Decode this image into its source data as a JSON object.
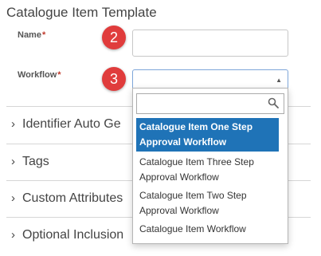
{
  "form": {
    "title": "Catalogue Item Template",
    "name_label": "Name",
    "workflow_label": "Workflow",
    "required_marker": "*",
    "name_value": "",
    "workflow_value": ""
  },
  "badges": {
    "name_step": "2",
    "workflow_step": "3"
  },
  "sections": [
    {
      "title": "Identifier Auto Ge",
      "icon": "chevron-right-icon"
    },
    {
      "title": "Tags",
      "icon": "chevron-right-icon"
    },
    {
      "title": "Custom Attributes",
      "icon": "chevron-right-icon"
    },
    {
      "title": "Optional Inclusion",
      "icon": "chevron-right-icon"
    }
  ],
  "dropdown": {
    "search_value": "",
    "options": [
      {
        "label": "Catalogue Item One Step Approval Workflow",
        "selected": true
      },
      {
        "label": "Catalogue Item Three Step Approval Workflow",
        "selected": false
      },
      {
        "label": "Catalogue Item Two Step Approval Workflow",
        "selected": false
      },
      {
        "label": "Catalogue Item Workflow",
        "selected": false
      }
    ]
  },
  "colors": {
    "selected_bg": "#1f73b7",
    "badge": "#e03c3c",
    "required": "#c0392b"
  }
}
